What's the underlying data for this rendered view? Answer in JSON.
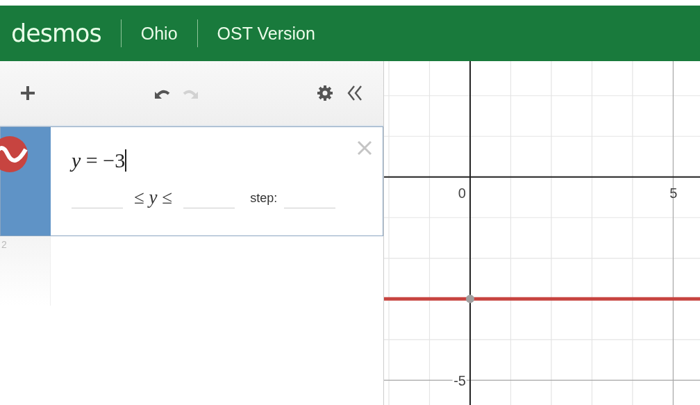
{
  "header": {
    "logo": "desmos",
    "items": [
      "Ohio",
      "OST Version"
    ]
  },
  "toolbar": {
    "buttons": [
      {
        "kind": "add",
        "disabled": false
      },
      {
        "kind": "undo",
        "disabled": false
      },
      {
        "kind": "redo",
        "disabled": true
      },
      {
        "kind": "settings",
        "disabled": false
      },
      {
        "kind": "collapse",
        "disabled": false
      }
    ]
  },
  "expressions": [
    {
      "kind": "slider-expression",
      "selected": true,
      "color": "#c74440",
      "latex": "*y* = −3",
      "bounds": "≤ *y* ≤",
      "step_label": "step:"
    },
    {
      "kind": "empty",
      "selected": false,
      "number": "2"
    }
  ],
  "graph": {
    "axis_labels": [
      {
        "kind": "origin",
        "text": "0"
      },
      {
        "kind": "x",
        "text": "5"
      },
      {
        "kind": "y",
        "text": "-5"
      }
    ]
  }
}
